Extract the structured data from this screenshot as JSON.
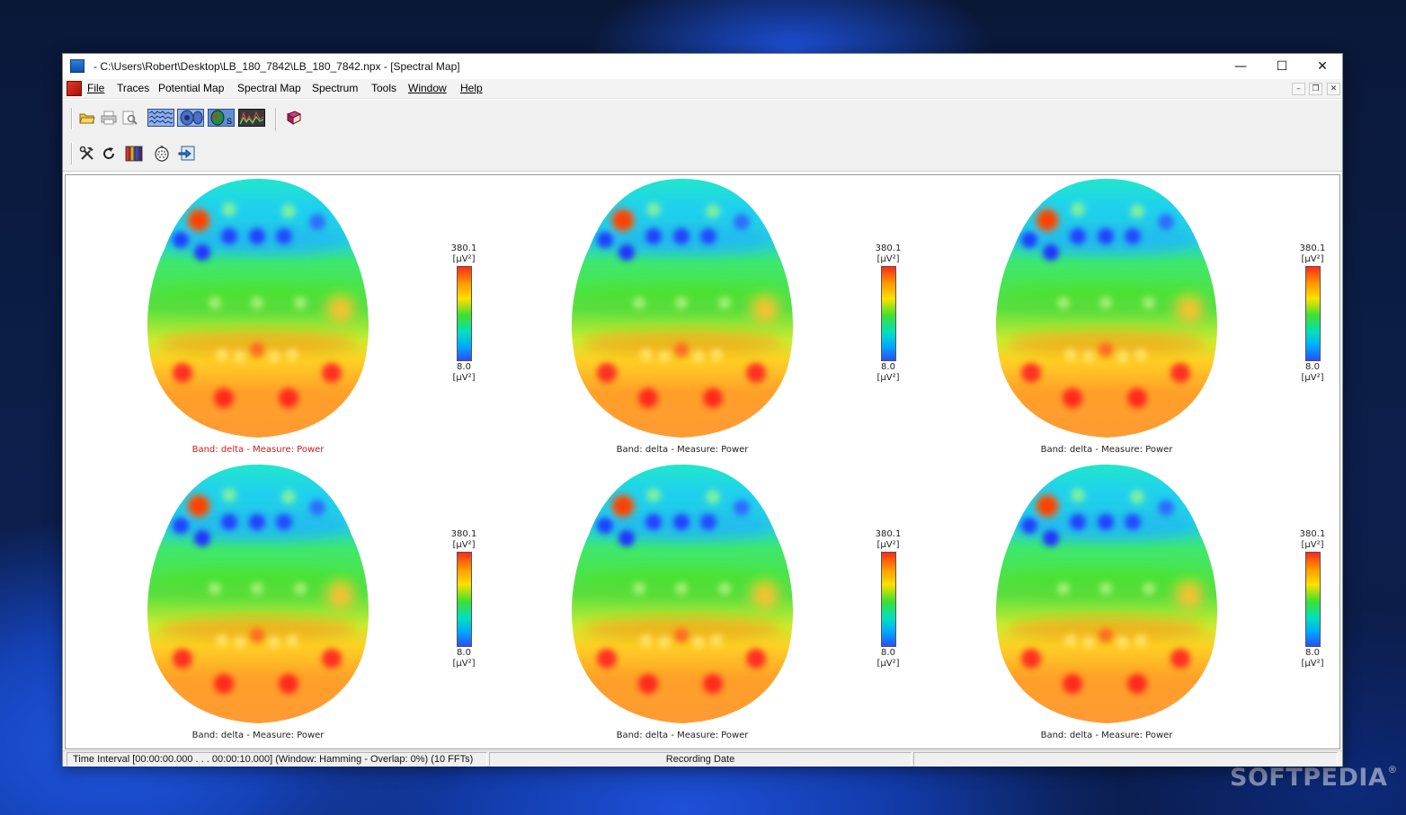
{
  "window": {
    "title": "- C:\\Users\\Robert\\Desktop\\LB_180_7842\\LB_180_7842.npx - [Spectral Map]",
    "minimize_glyph": "—",
    "maximize_glyph": "☐",
    "close_glyph": "✕"
  },
  "menu": [
    {
      "label": "File",
      "underline": true
    },
    {
      "label": "Traces",
      "underline": false
    },
    {
      "label": "Potential Map",
      "underline": false
    },
    {
      "label": "Spectral Map",
      "underline": false
    },
    {
      "label": "Spectrum",
      "underline": false
    },
    {
      "label": "Tools",
      "underline": false
    },
    {
      "label": "Window",
      "underline": true
    },
    {
      "label": "Help",
      "underline": true
    }
  ],
  "mdi": {
    "minimize": "–",
    "restore": "❐",
    "close": "✕"
  },
  "toolbar": {
    "row1": [
      "open-folder-icon",
      "print-icon",
      "print-preview-icon",
      "traces-view-icon",
      "potential-map-icon",
      "spectral-map-icon",
      "spectrum-icon",
      "book-icon"
    ],
    "row2": [
      "tools-icon",
      "refresh-icon",
      "color-bars-icon",
      "head-electrodes-icon",
      "export-icon"
    ]
  },
  "maps": [
    {
      "caption": "Band: delta - Measure: Power",
      "scale_max": "380.1",
      "scale_min": "8.0",
      "unit": "[µV²]",
      "active": true
    },
    {
      "caption": "Band: delta - Measure: Power",
      "scale_max": "380.1",
      "scale_min": "8.0",
      "unit": "[µV²]",
      "active": false
    },
    {
      "caption": "Band: delta - Measure: Power",
      "scale_max": "380.1",
      "scale_min": "8.0",
      "unit": "[µV²]",
      "active": false
    },
    {
      "caption": "Band: delta - Measure: Power",
      "scale_max": "380.1",
      "scale_min": "8.0",
      "unit": "[µV²]",
      "active": false
    },
    {
      "caption": "Band: delta - Measure: Power",
      "scale_max": "380.1",
      "scale_min": "8.0",
      "unit": "[µV²]",
      "active": false
    },
    {
      "caption": "Band: delta - Measure: Power",
      "scale_max": "380.1",
      "scale_min": "8.0",
      "unit": "[µV²]",
      "active": false
    }
  ],
  "colors": {
    "active_caption": "#d21a1a",
    "scale_top": "#ff2a1a",
    "scale_bottom": "#2b4dff"
  },
  "status": {
    "time_interval": "Time Interval [00:00:00.000 . . . 00:00:10.000] (Window: Hamming - Overlap: 0%) (10 FFTs)",
    "recording_date": "Recording Date",
    "extra": ""
  },
  "watermark": {
    "text": "SOFTPEDIA",
    "mark": "®"
  }
}
